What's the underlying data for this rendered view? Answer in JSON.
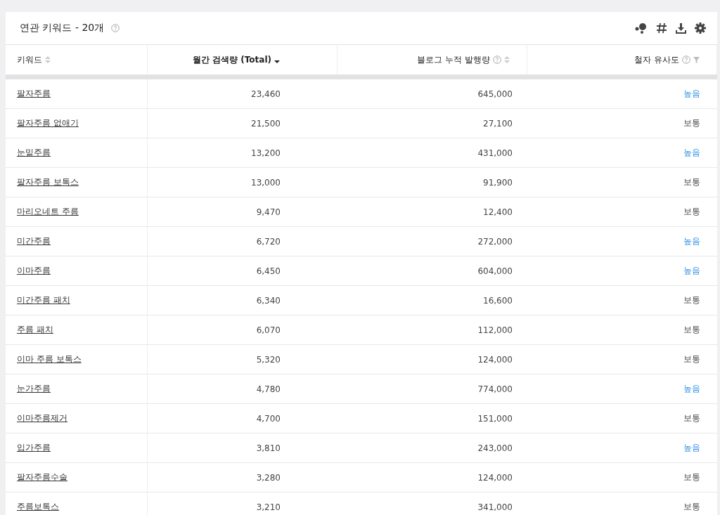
{
  "panel": {
    "title": "연관 키워드 - 20개"
  },
  "columns": [
    {
      "label": "키워드",
      "sortable": true,
      "sorted_desc": false,
      "help": false,
      "filter": false
    },
    {
      "label": "월간 검색량 (Total)",
      "sortable": true,
      "sorted_desc": true,
      "help": false,
      "filter": false
    },
    {
      "label": "블로그 누적 발행량",
      "sortable": true,
      "sorted_desc": false,
      "help": true,
      "filter": false
    },
    {
      "label": "철자 유사도",
      "sortable": false,
      "sorted_desc": false,
      "help": true,
      "filter": true
    }
  ],
  "rows": [
    {
      "keyword": "팔자주름",
      "volume": "23,460",
      "blog": "645,000",
      "similarity": "높음",
      "kind": "high"
    },
    {
      "keyword": "팔자주름 없애기",
      "volume": "21,500",
      "blog": "27,100",
      "similarity": "보통",
      "kind": "normal"
    },
    {
      "keyword": "눈밑주름",
      "volume": "13,200",
      "blog": "431,000",
      "similarity": "높음",
      "kind": "high"
    },
    {
      "keyword": "팔자주름 보톡스",
      "volume": "13,000",
      "blog": "91,900",
      "similarity": "보통",
      "kind": "normal"
    },
    {
      "keyword": "마리오네트 주름",
      "volume": "9,470",
      "blog": "12,400",
      "similarity": "보통",
      "kind": "normal"
    },
    {
      "keyword": "미간주름",
      "volume": "6,720",
      "blog": "272,000",
      "similarity": "높음",
      "kind": "high"
    },
    {
      "keyword": "이마주름",
      "volume": "6,450",
      "blog": "604,000",
      "similarity": "높음",
      "kind": "high"
    },
    {
      "keyword": "미간주름 패치",
      "volume": "6,340",
      "blog": "16,600",
      "similarity": "보통",
      "kind": "normal"
    },
    {
      "keyword": "주름 패치",
      "volume": "6,070",
      "blog": "112,000",
      "similarity": "보통",
      "kind": "normal"
    },
    {
      "keyword": "이마 주름 보톡스",
      "volume": "5,320",
      "blog": "124,000",
      "similarity": "보통",
      "kind": "normal"
    },
    {
      "keyword": "눈가주름",
      "volume": "4,780",
      "blog": "774,000",
      "similarity": "높음",
      "kind": "high"
    },
    {
      "keyword": "이마주름제거",
      "volume": "4,700",
      "blog": "151,000",
      "similarity": "보통",
      "kind": "normal"
    },
    {
      "keyword": "입가주름",
      "volume": "3,810",
      "blog": "243,000",
      "similarity": "높음",
      "kind": "high"
    },
    {
      "keyword": "팔자주름수술",
      "volume": "3,280",
      "blog": "124,000",
      "similarity": "보통",
      "kind": "normal"
    },
    {
      "keyword": "주름보톡스",
      "volume": "3,210",
      "blog": "341,000",
      "similarity": "보통",
      "kind": "normal"
    }
  ]
}
